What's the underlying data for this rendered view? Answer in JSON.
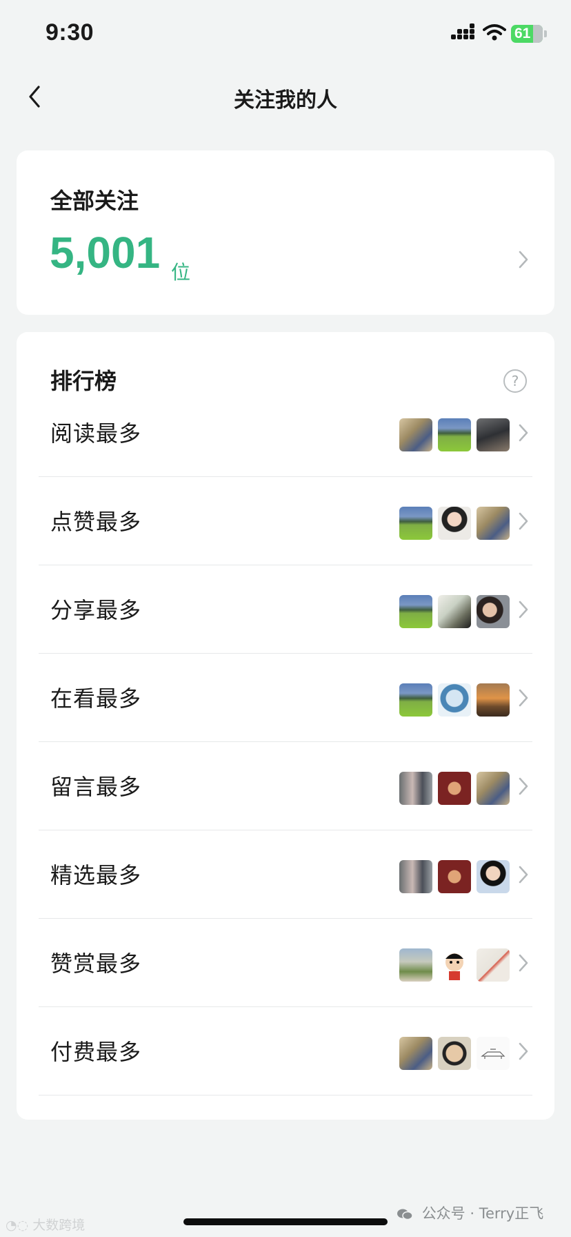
{
  "status_bar": {
    "time": "9:30",
    "battery": "61"
  },
  "nav": {
    "title": "关注我的人"
  },
  "summary": {
    "label": "全部关注",
    "count": "5,001",
    "unit": "位"
  },
  "ranking": {
    "title": "排行榜",
    "help_symbol": "?",
    "rows": [
      {
        "label": "阅读最多",
        "thumbs": [
          "crowd-photo",
          "mountain-photo",
          "dark-photo"
        ]
      },
      {
        "label": "点赞最多",
        "thumbs": [
          "mountain-photo",
          "girl-photo",
          "crowd-photo"
        ]
      },
      {
        "label": "分享最多",
        "thumbs": [
          "mountain-photo",
          "room-photo",
          "woman-photo"
        ]
      },
      {
        "label": "在看最多",
        "thumbs": [
          "mountain-photo",
          "robot-photo",
          "sunset-photo"
        ]
      },
      {
        "label": "留言最多",
        "thumbs": [
          "street-photo",
          "red-photo",
          "crowd-photo"
        ]
      },
      {
        "label": "精选最多",
        "thumbs": [
          "street-photo",
          "red-photo",
          "graduate-photo"
        ]
      },
      {
        "label": "赞赏最多",
        "thumbs": [
          "palms-photo",
          "cartoon-photo",
          "stamp-photo"
        ]
      },
      {
        "label": "付费最多",
        "thumbs": [
          "crowd-photo",
          "glasses-photo",
          "sketch-photo"
        ]
      }
    ]
  },
  "watermarks": {
    "left": "大数跨境",
    "right": "公众号 · Terry正飞"
  }
}
